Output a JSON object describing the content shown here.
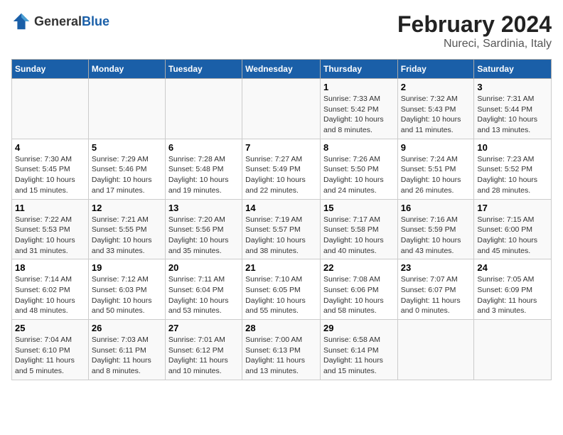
{
  "header": {
    "logo": {
      "general": "General",
      "blue": "Blue"
    },
    "title": "February 2024",
    "subtitle": "Nureci, Sardinia, Italy"
  },
  "weekdays": [
    "Sunday",
    "Monday",
    "Tuesday",
    "Wednesday",
    "Thursday",
    "Friday",
    "Saturday"
  ],
  "weeks": [
    [
      {
        "day": "",
        "info": ""
      },
      {
        "day": "",
        "info": ""
      },
      {
        "day": "",
        "info": ""
      },
      {
        "day": "",
        "info": ""
      },
      {
        "day": "1",
        "info": "Sunrise: 7:33 AM\nSunset: 5:42 PM\nDaylight: 10 hours and 8 minutes."
      },
      {
        "day": "2",
        "info": "Sunrise: 7:32 AM\nSunset: 5:43 PM\nDaylight: 10 hours and 11 minutes."
      },
      {
        "day": "3",
        "info": "Sunrise: 7:31 AM\nSunset: 5:44 PM\nDaylight: 10 hours and 13 minutes."
      }
    ],
    [
      {
        "day": "4",
        "info": "Sunrise: 7:30 AM\nSunset: 5:45 PM\nDaylight: 10 hours and 15 minutes."
      },
      {
        "day": "5",
        "info": "Sunrise: 7:29 AM\nSunset: 5:46 PM\nDaylight: 10 hours and 17 minutes."
      },
      {
        "day": "6",
        "info": "Sunrise: 7:28 AM\nSunset: 5:48 PM\nDaylight: 10 hours and 19 minutes."
      },
      {
        "day": "7",
        "info": "Sunrise: 7:27 AM\nSunset: 5:49 PM\nDaylight: 10 hours and 22 minutes."
      },
      {
        "day": "8",
        "info": "Sunrise: 7:26 AM\nSunset: 5:50 PM\nDaylight: 10 hours and 24 minutes."
      },
      {
        "day": "9",
        "info": "Sunrise: 7:24 AM\nSunset: 5:51 PM\nDaylight: 10 hours and 26 minutes."
      },
      {
        "day": "10",
        "info": "Sunrise: 7:23 AM\nSunset: 5:52 PM\nDaylight: 10 hours and 28 minutes."
      }
    ],
    [
      {
        "day": "11",
        "info": "Sunrise: 7:22 AM\nSunset: 5:53 PM\nDaylight: 10 hours and 31 minutes."
      },
      {
        "day": "12",
        "info": "Sunrise: 7:21 AM\nSunset: 5:55 PM\nDaylight: 10 hours and 33 minutes."
      },
      {
        "day": "13",
        "info": "Sunrise: 7:20 AM\nSunset: 5:56 PM\nDaylight: 10 hours and 35 minutes."
      },
      {
        "day": "14",
        "info": "Sunrise: 7:19 AM\nSunset: 5:57 PM\nDaylight: 10 hours and 38 minutes."
      },
      {
        "day": "15",
        "info": "Sunrise: 7:17 AM\nSunset: 5:58 PM\nDaylight: 10 hours and 40 minutes."
      },
      {
        "day": "16",
        "info": "Sunrise: 7:16 AM\nSunset: 5:59 PM\nDaylight: 10 hours and 43 minutes."
      },
      {
        "day": "17",
        "info": "Sunrise: 7:15 AM\nSunset: 6:00 PM\nDaylight: 10 hours and 45 minutes."
      }
    ],
    [
      {
        "day": "18",
        "info": "Sunrise: 7:14 AM\nSunset: 6:02 PM\nDaylight: 10 hours and 48 minutes."
      },
      {
        "day": "19",
        "info": "Sunrise: 7:12 AM\nSunset: 6:03 PM\nDaylight: 10 hours and 50 minutes."
      },
      {
        "day": "20",
        "info": "Sunrise: 7:11 AM\nSunset: 6:04 PM\nDaylight: 10 hours and 53 minutes."
      },
      {
        "day": "21",
        "info": "Sunrise: 7:10 AM\nSunset: 6:05 PM\nDaylight: 10 hours and 55 minutes."
      },
      {
        "day": "22",
        "info": "Sunrise: 7:08 AM\nSunset: 6:06 PM\nDaylight: 10 hours and 58 minutes."
      },
      {
        "day": "23",
        "info": "Sunrise: 7:07 AM\nSunset: 6:07 PM\nDaylight: 11 hours and 0 minutes."
      },
      {
        "day": "24",
        "info": "Sunrise: 7:05 AM\nSunset: 6:09 PM\nDaylight: 11 hours and 3 minutes."
      }
    ],
    [
      {
        "day": "25",
        "info": "Sunrise: 7:04 AM\nSunset: 6:10 PM\nDaylight: 11 hours and 5 minutes."
      },
      {
        "day": "26",
        "info": "Sunrise: 7:03 AM\nSunset: 6:11 PM\nDaylight: 11 hours and 8 minutes."
      },
      {
        "day": "27",
        "info": "Sunrise: 7:01 AM\nSunset: 6:12 PM\nDaylight: 11 hours and 10 minutes."
      },
      {
        "day": "28",
        "info": "Sunrise: 7:00 AM\nSunset: 6:13 PM\nDaylight: 11 hours and 13 minutes."
      },
      {
        "day": "29",
        "info": "Sunrise: 6:58 AM\nSunset: 6:14 PM\nDaylight: 11 hours and 15 minutes."
      },
      {
        "day": "",
        "info": ""
      },
      {
        "day": "",
        "info": ""
      }
    ]
  ]
}
